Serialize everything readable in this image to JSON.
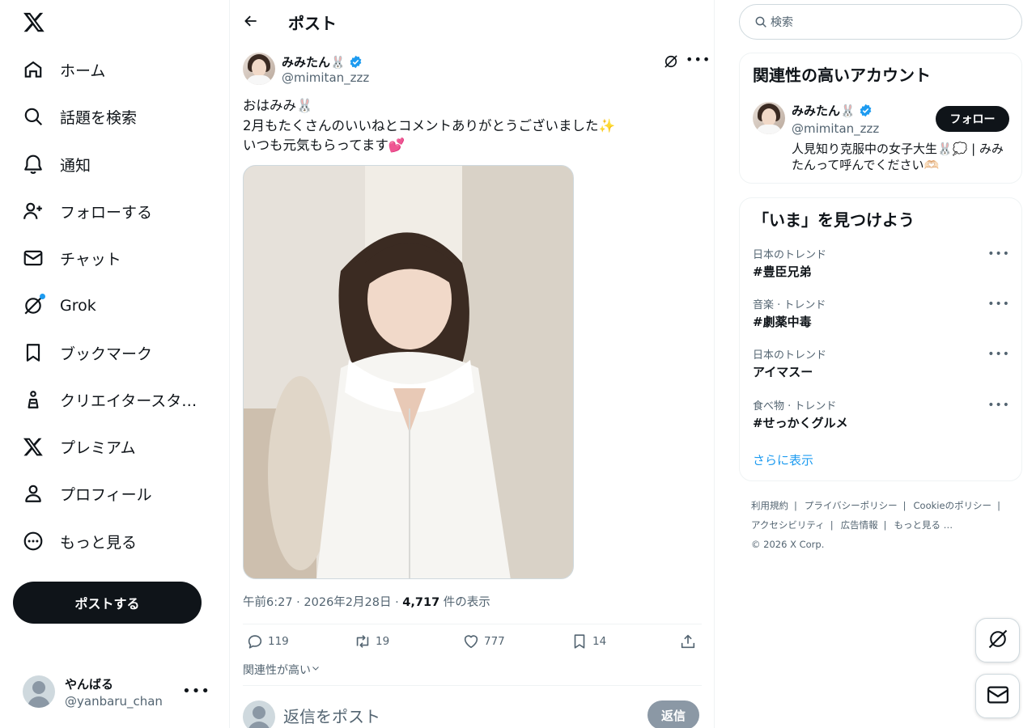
{
  "nav": {
    "items": [
      {
        "label": "ホーム",
        "icon": "home-icon"
      },
      {
        "label": "話題を検索",
        "icon": "search-icon"
      },
      {
        "label": "通知",
        "icon": "bell-icon"
      },
      {
        "label": "フォローする",
        "icon": "person-plus-icon"
      },
      {
        "label": "チャット",
        "icon": "mail-icon"
      },
      {
        "label": "Grok",
        "icon": "grok-icon"
      },
      {
        "label": "ブックマーク",
        "icon": "bookmark-icon"
      },
      {
        "label": "クリエイタースタ…",
        "icon": "creator-studio-icon"
      },
      {
        "label": "プレミアム",
        "icon": "x-premium-icon"
      },
      {
        "label": "プロフィール",
        "icon": "person-icon"
      },
      {
        "label": "もっと見る",
        "icon": "more-circle-icon"
      }
    ],
    "post_button": "ポストする",
    "account": {
      "name": "やんばる",
      "handle": "@yanbaru_chan"
    }
  },
  "header": {
    "title": "ポスト"
  },
  "tweet": {
    "author_name": "みみたん🐰",
    "author_handle": "@mimitan_zzz",
    "lines": [
      "おはみみ🐰",
      "2月もたくさんのいいねとコメントありがとうございました✨",
      "いつも元気もらってます💕"
    ],
    "time": "午前6:27 · 2026年2月28日 · ",
    "views": "4,717",
    "views_label": " 件の表示",
    "replies": "119",
    "reposts": "19",
    "likes": "777",
    "bookmarks": "14",
    "relevance_label": "関連性が高い"
  },
  "reply": {
    "placeholder": "返信をポスト",
    "button": "返信"
  },
  "search": {
    "placeholder": "検索"
  },
  "related": {
    "title": "関連性の高いアカウント",
    "name": "みみたん🐰",
    "handle": "@mimitan_zzz",
    "follow": "フォロー",
    "bio": "人見知り克服中の女子大生🐰💭 | みみたんって呼んでください🫶🏻"
  },
  "trends": {
    "title": "「いま」を見つけよう",
    "items": [
      {
        "context": "日本のトレンド",
        "name": "#豊臣兄弟"
      },
      {
        "context": "音楽 · トレンド",
        "name": "#劇薬中毒"
      },
      {
        "context": "日本のトレンド",
        "name": "アイマスー"
      },
      {
        "context": "食べ物 · トレンド",
        "name": "#せっかくグルメ"
      }
    ],
    "show_more": "さらに表示"
  },
  "footer": {
    "links": [
      "利用規約",
      "プライバシーポリシー",
      "Cookieのポリシー",
      "アクセシビリティ",
      "広告情報",
      "もっと見る …"
    ],
    "copyright": "© 2026 X Corp."
  },
  "colors": {
    "accent": "#1d9bf0",
    "text": "#0f1419",
    "muted": "#536471",
    "border": "#eff3f4"
  }
}
